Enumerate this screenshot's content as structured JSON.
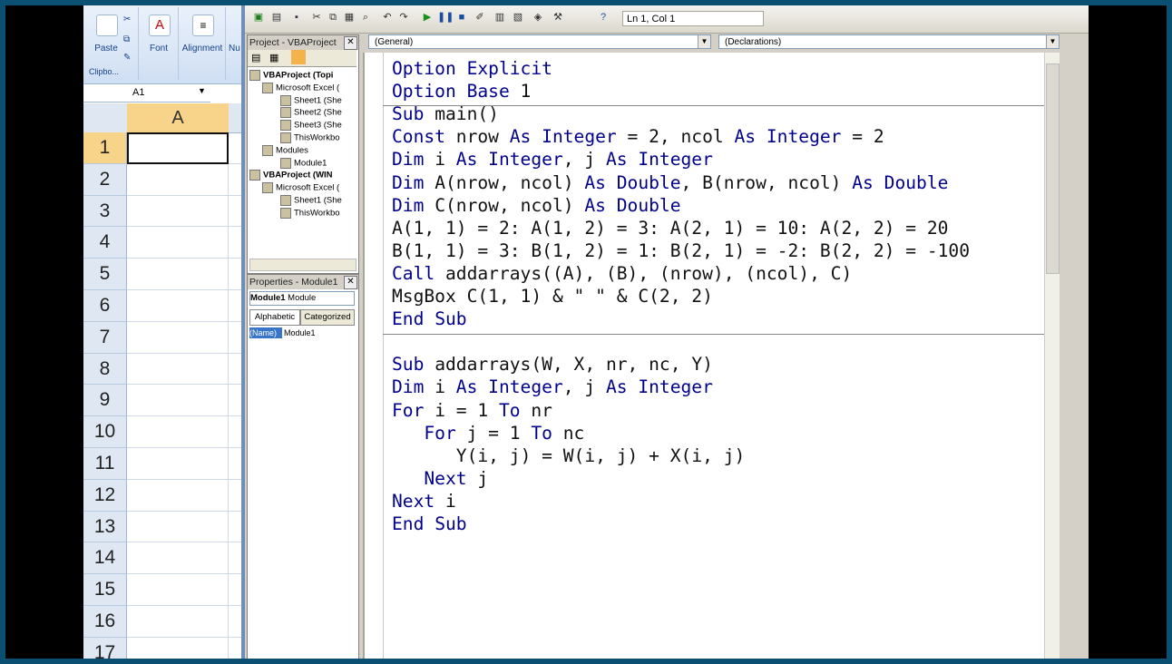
{
  "excel": {
    "ribbon": {
      "paste_label": "Paste",
      "font_label": "Font",
      "alignment_label": "Alignment",
      "number_label": "Nu",
      "clipboard_label": "Clipbo..."
    },
    "namebox": "A1",
    "column_header": "A",
    "rows": [
      "1",
      "2",
      "3",
      "4",
      "5",
      "6",
      "7",
      "8",
      "9",
      "10",
      "11",
      "12",
      "13",
      "14",
      "15",
      "16",
      "17"
    ]
  },
  "vbe": {
    "status": "Ln 1, Col 1",
    "project": {
      "title": "Project - VBAProject",
      "items": [
        {
          "label": "VBAProject (Topi",
          "bold": true
        },
        {
          "label": "Microsoft Excel (",
          "bold": false
        },
        {
          "label": "Sheet1 (She",
          "bold": false
        },
        {
          "label": "Sheet2 (She",
          "bold": false
        },
        {
          "label": "Sheet3 (She",
          "bold": false
        },
        {
          "label": "ThisWorkbo",
          "bold": false
        },
        {
          "label": "Modules",
          "bold": false
        },
        {
          "label": "Module1",
          "bold": false
        },
        {
          "label": "VBAProject (WIN",
          "bold": true
        },
        {
          "label": "Microsoft Excel (",
          "bold": false
        },
        {
          "label": "Sheet1 (She",
          "bold": false
        },
        {
          "label": "ThisWorkbo",
          "bold": false
        }
      ]
    },
    "properties": {
      "title": "Properties - Module1",
      "object_name": "Module1",
      "object_type": "Module",
      "tab_alphabetic": "Alphabetic",
      "tab_categorized": "Categorized",
      "prop_name": "(Name)",
      "prop_value": "Module1"
    },
    "object_combo": "(General)",
    "proc_combo": "(Declarations)",
    "code_lines": [
      "Option Explicit",
      "Option Base 1",
      "Sub main()",
      "Const nrow As Integer = 2, ncol As Integer = 2",
      "Dim i As Integer, j As Integer",
      "Dim A(nrow, ncol) As Double, B(nrow, ncol) As Double",
      "Dim C(nrow, ncol) As Double",
      "A(1, 1) = 2: A(1, 2) = 3: A(2, 1) = 10: A(2, 2) = 20",
      "B(1, 1) = 3: B(1, 2) = 1: B(2, 1) = -2: B(2, 2) = -100",
      "Call addarrays((A), (B), (nrow), (ncol), C)",
      "MsgBox C(1, 1) & \" \" & C(2, 2)",
      "End Sub",
      "",
      "Sub addarrays(W, X, nr, nc, Y)",
      "Dim i As Integer, j As Integer",
      "For i = 1 To nr",
      "   For j = 1 To nc",
      "      Y(i, j) = W(i, j) + X(i, j)",
      "   Next j",
      "Next i",
      "End Sub"
    ]
  }
}
